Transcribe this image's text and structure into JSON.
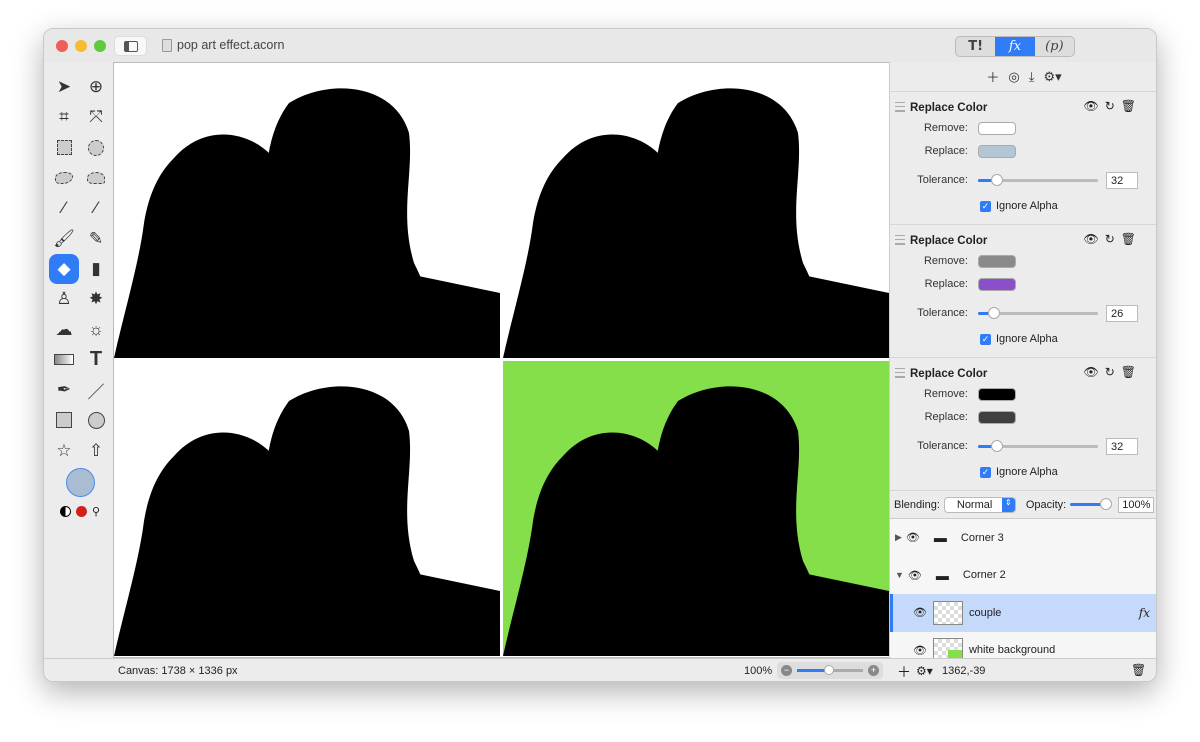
{
  "window": {
    "title": "pop art effect.acorn"
  },
  "panel_tabs": [
    {
      "label": "T!",
      "active": false
    },
    {
      "label": "fx",
      "active": true
    },
    {
      "label": "(p)",
      "active": false
    }
  ],
  "panel_toolbar": [
    "plus-icon",
    "filter-stack-icon",
    "download-icon",
    "gear-menu-icon"
  ],
  "tools": [
    "arrow",
    "zoom",
    "crop",
    "transform",
    "rect-select",
    "ellipse-select",
    "lasso",
    "polygon-lasso",
    "magic-wand",
    "color-wand",
    "brush",
    "pencil",
    "fill-bucket",
    "eraser",
    "stamp",
    "smudge",
    "cloud",
    "sun",
    "gradient",
    "text",
    "pen",
    "line",
    "rectangle",
    "circle",
    "star",
    "arrow-shape"
  ],
  "selected_tool": "fill-bucket",
  "colors": {
    "foreground": "#a9bdd2",
    "accent": "#2f7cf6",
    "green_bg": "#84df4a"
  },
  "filters": [
    {
      "title": "Replace Color",
      "remove_label": "Remove:",
      "replace_label": "Replace:",
      "tolerance_label": "Tolerance:",
      "remove_color": "#ffffff",
      "replace_color": "#b3c6d6",
      "tolerance": "32",
      "ignore_alpha": "Ignore Alpha",
      "checked": true
    },
    {
      "title": "Replace Color",
      "remove_label": "Remove:",
      "replace_label": "Replace:",
      "tolerance_label": "Tolerance:",
      "remove_color": "#8a8a8a",
      "replace_color": "#8a4fc9",
      "tolerance": "26",
      "ignore_alpha": "Ignore Alpha",
      "checked": true
    },
    {
      "title": "Replace Color",
      "remove_label": "Remove:",
      "replace_label": "Replace:",
      "tolerance_label": "Tolerance:",
      "remove_color": "#000000",
      "replace_color": "#3f3f3f",
      "tolerance": "32",
      "ignore_alpha": "Ignore Alpha",
      "checked": true
    }
  ],
  "blend": {
    "label": "Blending:",
    "value": "Normal",
    "opacity_label": "Opacity:",
    "opacity": "100%"
  },
  "layers": [
    {
      "name": "Corner 3",
      "type": "group",
      "expanded": false
    },
    {
      "name": "Corner 2",
      "type": "group",
      "expanded": true
    },
    {
      "name": "couple",
      "type": "image",
      "selected": true,
      "fx": "fx"
    },
    {
      "name": "white background",
      "type": "image"
    }
  ],
  "status": {
    "canvas": "Canvas: 1738 × 1336 px",
    "zoom": "100%",
    "coords": "1362,-39"
  }
}
